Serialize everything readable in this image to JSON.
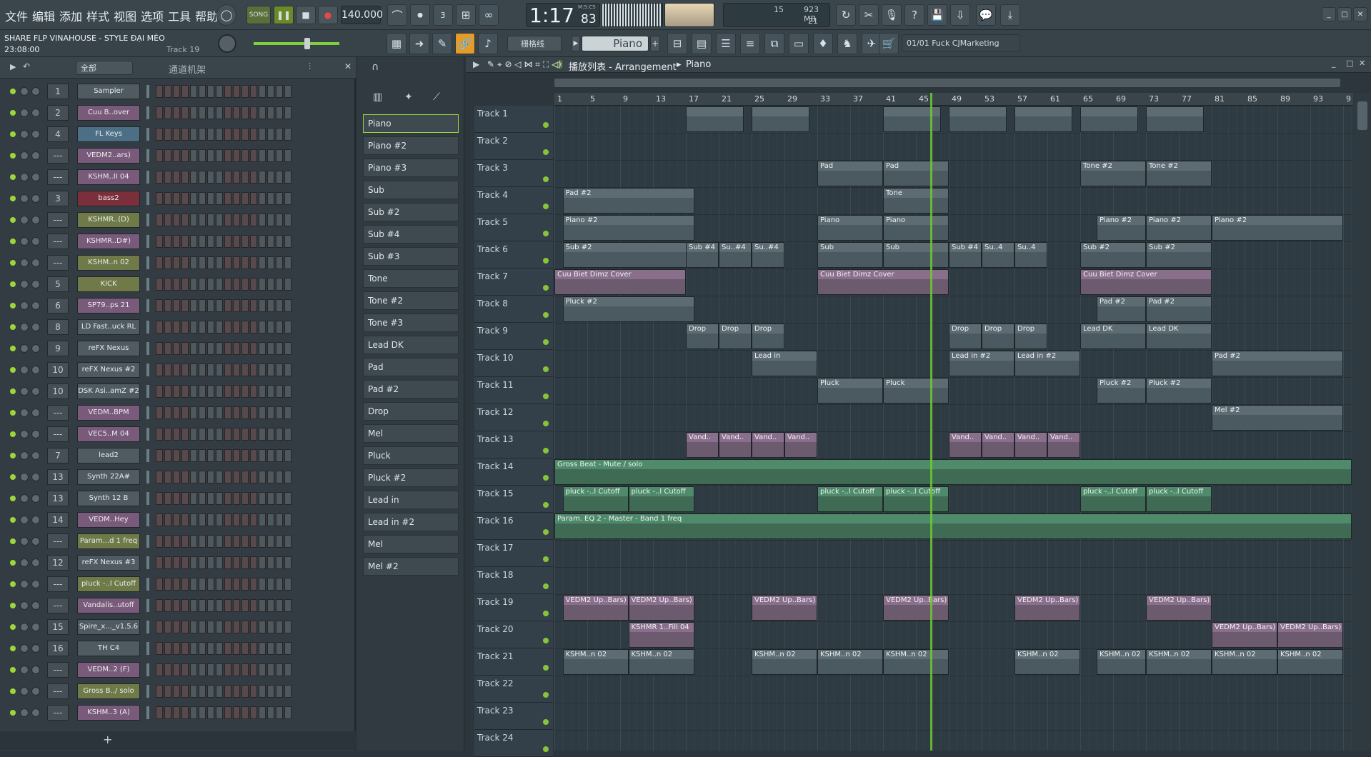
{
  "menu": [
    "文件",
    "编辑",
    "添加",
    "样式",
    "视图",
    "选项",
    "工具",
    "帮助"
  ],
  "transport": {
    "mode": "SONG",
    "tempo": "140.000",
    "time": "1:17",
    "time_small": "83",
    "time_unit": "M:S:CS",
    "cpu": "15",
    "mem": "923 MB",
    "poly": "21"
  },
  "project": {
    "title": "SHARE FLP VINAHOUSE - STYLE ĐẠI MÈO",
    "time": "23:08:00",
    "track": "Track 19"
  },
  "snap": "栅格线",
  "instrument": "Piano",
  "hint": "01/01  Fuck CJMarketing",
  "channel_rack": {
    "filter": "全部",
    "title": "通道机架",
    "channels": [
      {
        "num": "1",
        "name": "Sampler",
        "color": "#4f5b61"
      },
      {
        "num": "2",
        "name": "Cuu B..over",
        "color": "#7a5a7a"
      },
      {
        "num": "4",
        "name": "FL Keys",
        "color": "#4d6f86"
      },
      {
        "num": "---",
        "name": "VEDM2..ars)",
        "color": "#7a5a7a"
      },
      {
        "num": "---",
        "name": "KSHM..II 04",
        "color": "#7a5a7a"
      },
      {
        "num": "3",
        "name": "bass2",
        "color": "#7b2f3a"
      },
      {
        "num": "---",
        "name": "KSHMR..(D)",
        "color": "#6f7a48"
      },
      {
        "num": "---",
        "name": "KSHMR..D#)",
        "color": "#7a5a7a"
      },
      {
        "num": "---",
        "name": "KSHM..n 02",
        "color": "#6f7a48"
      },
      {
        "num": "5",
        "name": "KICK",
        "color": "#6f7a48"
      },
      {
        "num": "6",
        "name": "SP79..ps 21",
        "color": "#7a5a7a"
      },
      {
        "num": "8",
        "name": "LD Fast..uck RL",
        "color": "#4f5b61"
      },
      {
        "num": "9",
        "name": "reFX Nexus",
        "color": "#4f5b61"
      },
      {
        "num": "10",
        "name": "reFX Nexus #2",
        "color": "#4f5b61"
      },
      {
        "num": "10",
        "name": "DSK Asi..amZ #2",
        "color": "#4f5b61"
      },
      {
        "num": "---",
        "name": "VEDM..BPM",
        "color": "#7a5a7a"
      },
      {
        "num": "---",
        "name": "VEC5..M 04",
        "color": "#7a5a7a"
      },
      {
        "num": "7",
        "name": "lead2",
        "color": "#4f5b61"
      },
      {
        "num": "13",
        "name": "Synth 22A#",
        "color": "#4f5b61"
      },
      {
        "num": "13",
        "name": "Synth 12 B",
        "color": "#4f5b61"
      },
      {
        "num": "14",
        "name": "VEDM..Hey",
        "color": "#7a5a7a"
      },
      {
        "num": "---",
        "name": "Param...d 1 freq",
        "color": "#6f7a48"
      },
      {
        "num": "12",
        "name": "reFX Nexus #3",
        "color": "#4f5b61"
      },
      {
        "num": "---",
        "name": "pluck -..l Cutoff",
        "color": "#6f7a48"
      },
      {
        "num": "---",
        "name": "Vandalis..utoff",
        "color": "#7a5a7a"
      },
      {
        "num": "15",
        "name": "Spire_x..._v1.5.6",
        "color": "#4f5b61"
      },
      {
        "num": "16",
        "name": "TH C4",
        "color": "#4f5b61"
      },
      {
        "num": "---",
        "name": "VEDM..2 (F)",
        "color": "#7a5a7a"
      },
      {
        "num": "---",
        "name": "Gross B../ solo",
        "color": "#6f7a48"
      },
      {
        "num": "---",
        "name": "KSHM..3 (A)",
        "color": "#7a5a7a"
      }
    ]
  },
  "picker": [
    "Piano",
    "Piano #2",
    "Piano #3",
    "Sub",
    "Sub #2",
    "Sub #4",
    "Sub #3",
    "Tone",
    "Tone #2",
    "Tone #3",
    "Lead DK",
    "Pad",
    "Pad #2",
    "Drop",
    "Mel",
    "Pluck",
    "Pluck #2",
    "Lead in",
    "Lead in #2",
    "Mel",
    "Mel #2"
  ],
  "playlist": {
    "title": "播放列表 - Arrangement",
    "crumb": "Piano",
    "ruler": [
      "1",
      "5",
      "9",
      "13",
      "17",
      "21",
      "25",
      "29",
      "33",
      "37",
      "41",
      "45",
      "49",
      "53",
      "57",
      "61",
      "65",
      "69",
      "73",
      "77",
      "81",
      "85",
      "89",
      "93",
      "9"
    ],
    "tracks": [
      "Track 1",
      "Track 2",
      "Track 3",
      "Track 4",
      "Track 5",
      "Track 6",
      "Track 7",
      "Track 8",
      "Track 9",
      "Track 10",
      "Track 11",
      "Track 12",
      "Track 13",
      "Track 14",
      "Track 15",
      "Track 16",
      "Track 17",
      "Track 18",
      "Track 19",
      "Track 20",
      "Track 21",
      "Track 22",
      "Track 23",
      "Track 24"
    ],
    "clips": [
      {
        "t": 0,
        "b": 17,
        "w": 7,
        "label": "",
        "type": "cn"
      },
      {
        "t": 0,
        "b": 25,
        "w": 7,
        "label": "",
        "type": "cn"
      },
      {
        "t": 0,
        "b": 41,
        "w": 7,
        "label": "",
        "type": "cn"
      },
      {
        "t": 0,
        "b": 49,
        "w": 7,
        "label": "",
        "type": "cn"
      },
      {
        "t": 0,
        "b": 57,
        "w": 7,
        "label": "",
        "type": "cn"
      },
      {
        "t": 0,
        "b": 65,
        "w": 7,
        "label": "",
        "type": "cn"
      },
      {
        "t": 0,
        "b": 73,
        "w": 7,
        "label": "",
        "type": "cn"
      },
      {
        "t": 2,
        "b": 33,
        "w": 8,
        "label": "Pad",
        "type": "cn"
      },
      {
        "t": 2,
        "b": 41,
        "w": 8,
        "label": "Pad",
        "type": "cn"
      },
      {
        "t": 2,
        "b": 65,
        "w": 8,
        "label": "Tone #2",
        "type": "cn"
      },
      {
        "t": 2,
        "b": 73,
        "w": 8,
        "label": "Tone #2",
        "type": "cn"
      },
      {
        "t": 3,
        "b": 2,
        "w": 16,
        "label": "Pad #2",
        "type": "cn"
      },
      {
        "t": 3,
        "b": 41,
        "w": 8,
        "label": "Tone",
        "type": "cn"
      },
      {
        "t": 4,
        "b": 2,
        "w": 16,
        "label": "Piano #2",
        "type": "cn"
      },
      {
        "t": 4,
        "b": 33,
        "w": 8,
        "label": "Piano",
        "type": "cn"
      },
      {
        "t": 4,
        "b": 41,
        "w": 8,
        "label": "Piano",
        "type": "cn"
      },
      {
        "t": 4,
        "b": 67,
        "w": 6,
        "label": "Piano #2",
        "type": "cn"
      },
      {
        "t": 4,
        "b": 73,
        "w": 8,
        "label": "Piano #2",
        "type": "cn"
      },
      {
        "t": 4,
        "b": 81,
        "w": 16,
        "label": "Piano #2",
        "type": "cn"
      },
      {
        "t": 5,
        "b": 2,
        "w": 16,
        "label": "Sub #2",
        "type": "cn"
      },
      {
        "t": 5,
        "b": 17,
        "w": 4,
        "label": "Sub #4",
        "type": "cn"
      },
      {
        "t": 5,
        "b": 21,
        "w": 4,
        "label": "Su..#4",
        "type": "cn"
      },
      {
        "t": 5,
        "b": 25,
        "w": 4,
        "label": "Su..#4",
        "type": "cn"
      },
      {
        "t": 5,
        "b": 33,
        "w": 8,
        "label": "Sub",
        "type": "cn"
      },
      {
        "t": 5,
        "b": 41,
        "w": 8,
        "label": "Sub",
        "type": "cn"
      },
      {
        "t": 5,
        "b": 49,
        "w": 4,
        "label": "Sub #4",
        "type": "cn"
      },
      {
        "t": 5,
        "b": 53,
        "w": 4,
        "label": "Su..4",
        "type": "cn"
      },
      {
        "t": 5,
        "b": 57,
        "w": 4,
        "label": "Su..4",
        "type": "cn"
      },
      {
        "t": 5,
        "b": 65,
        "w": 8,
        "label": "Sub #2",
        "type": "cn"
      },
      {
        "t": 5,
        "b": 73,
        "w": 8,
        "label": "Sub #2",
        "type": "cn"
      },
      {
        "t": 6,
        "b": 1,
        "w": 16,
        "label": "Cuu Biet Dimz Cover",
        "type": "ca"
      },
      {
        "t": 6,
        "b": 33,
        "w": 16,
        "label": "Cuu Biet Dimz Cover",
        "type": "ca"
      },
      {
        "t": 6,
        "b": 65,
        "w": 16,
        "label": "Cuu Biet Dimz Cover",
        "type": "ca"
      },
      {
        "t": 7,
        "b": 2,
        "w": 16,
        "label": "Pluck #2",
        "type": "cn"
      },
      {
        "t": 7,
        "b": 67,
        "w": 6,
        "label": "Pad #2",
        "type": "cn"
      },
      {
        "t": 7,
        "b": 73,
        "w": 8,
        "label": "Pad #2",
        "type": "cn"
      },
      {
        "t": 8,
        "b": 17,
        "w": 4,
        "label": "Drop",
        "type": "cn"
      },
      {
        "t": 8,
        "b": 21,
        "w": 4,
        "label": "Drop",
        "type": "cn"
      },
      {
        "t": 8,
        "b": 25,
        "w": 4,
        "label": "Drop",
        "type": "cn"
      },
      {
        "t": 8,
        "b": 49,
        "w": 4,
        "label": "Drop",
        "type": "cn"
      },
      {
        "t": 8,
        "b": 53,
        "w": 4,
        "label": "Drop",
        "type": "cn"
      },
      {
        "t": 8,
        "b": 57,
        "w": 4,
        "label": "Drop",
        "type": "cn"
      },
      {
        "t": 8,
        "b": 65,
        "w": 8,
        "label": "Lead DK",
        "type": "cn"
      },
      {
        "t": 8,
        "b": 73,
        "w": 8,
        "label": "Lead DK",
        "type": "cn"
      },
      {
        "t": 9,
        "b": 25,
        "w": 8,
        "label": "Lead in",
        "type": "cn"
      },
      {
        "t": 9,
        "b": 49,
        "w": 8,
        "label": "Lead in #2",
        "type": "cn"
      },
      {
        "t": 9,
        "b": 57,
        "w": 8,
        "label": "Lead in #2",
        "type": "cn"
      },
      {
        "t": 9,
        "b": 81,
        "w": 16,
        "label": "Pad #2",
        "type": "cn"
      },
      {
        "t": 10,
        "b": 33,
        "w": 8,
        "label": "Pluck",
        "type": "cn"
      },
      {
        "t": 10,
        "b": 41,
        "w": 8,
        "label": "Pluck",
        "type": "cn"
      },
      {
        "t": 10,
        "b": 67,
        "w": 6,
        "label": "Pluck #2",
        "type": "cn"
      },
      {
        "t": 10,
        "b": 73,
        "w": 8,
        "label": "Pluck #2",
        "type": "cn"
      },
      {
        "t": 11,
        "b": 81,
        "w": 16,
        "label": "Mel #2",
        "type": "cn"
      },
      {
        "t": 12,
        "b": 17,
        "w": 4,
        "label": "Vand..",
        "type": "ca"
      },
      {
        "t": 12,
        "b": 21,
        "w": 4,
        "label": "Vand..",
        "type": "ca"
      },
      {
        "t": 12,
        "b": 25,
        "w": 4,
        "label": "Vand..",
        "type": "ca"
      },
      {
        "t": 12,
        "b": 29,
        "w": 4,
        "label": "Vand..",
        "type": "ca"
      },
      {
        "t": 12,
        "b": 49,
        "w": 4,
        "label": "Vand..",
        "type": "ca"
      },
      {
        "t": 12,
        "b": 53,
        "w": 4,
        "label": "Vand..",
        "type": "ca"
      },
      {
        "t": 12,
        "b": 57,
        "w": 4,
        "label": "Vand..",
        "type": "ca"
      },
      {
        "t": 12,
        "b": 61,
        "w": 4,
        "label": "Vand..",
        "type": "ca"
      },
      {
        "t": 13,
        "b": 1,
        "w": 97,
        "label": "Gross Beat - Mute / solo",
        "type": "cg"
      },
      {
        "t": 14,
        "b": 2,
        "w": 8,
        "label": "pluck -..l Cutoff",
        "type": "cg"
      },
      {
        "t": 14,
        "b": 10,
        "w": 8,
        "label": "pluck -..l Cutoff",
        "type": "cg"
      },
      {
        "t": 14,
        "b": 33,
        "w": 8,
        "label": "pluck -..l Cutoff",
        "type": "cg"
      },
      {
        "t": 14,
        "b": 41,
        "w": 8,
        "label": "pluck -..l Cutoff",
        "type": "cg"
      },
      {
        "t": 14,
        "b": 65,
        "w": 8,
        "label": "pluck -..l Cutoff",
        "type": "cg"
      },
      {
        "t": 14,
        "b": 73,
        "w": 8,
        "label": "pluck -..l Cutoff",
        "type": "cg"
      },
      {
        "t": 15,
        "b": 1,
        "w": 97,
        "label": "Param. EQ 2 - Master - Band 1 freq",
        "type": "cg"
      },
      {
        "t": 18,
        "b": 2,
        "w": 8,
        "label": "VEDM2 Up..Bars)",
        "type": "ca"
      },
      {
        "t": 18,
        "b": 10,
        "w": 8,
        "label": "VEDM2 Up..Bars)",
        "type": "ca"
      },
      {
        "t": 18,
        "b": 25,
        "w": 8,
        "label": "VEDM2 Up..Bars)",
        "type": "ca"
      },
      {
        "t": 18,
        "b": 41,
        "w": 8,
        "label": "VEDM2 Up..Bars)",
        "type": "ca"
      },
      {
        "t": 18,
        "b": 57,
        "w": 8,
        "label": "VEDM2 Up..Bars)",
        "type": "ca"
      },
      {
        "t": 18,
        "b": 73,
        "w": 8,
        "label": "VEDM2 Up..Bars)",
        "type": "ca"
      },
      {
        "t": 19,
        "b": 10,
        "w": 8,
        "label": "KSHMR 1..Fill 04",
        "type": "ca"
      },
      {
        "t": 19,
        "b": 81,
        "w": 8,
        "label": "VEDM2 Up..Bars)",
        "type": "ca"
      },
      {
        "t": 19,
        "b": 89,
        "w": 8,
        "label": "VEDM2 Up..Bars)",
        "type": "ca"
      },
      {
        "t": 20,
        "b": 2,
        "w": 8,
        "label": "KSHM..n 02",
        "type": "cn"
      },
      {
        "t": 20,
        "b": 10,
        "w": 8,
        "label": "KSHM..n 02",
        "type": "cn"
      },
      {
        "t": 20,
        "b": 25,
        "w": 8,
        "label": "KSHM..n 02",
        "type": "cn"
      },
      {
        "t": 20,
        "b": 33,
        "w": 8,
        "label": "KSHM..n 02",
        "type": "cn"
      },
      {
        "t": 20,
        "b": 41,
        "w": 8,
        "label": "KSHM..n 02",
        "type": "cn"
      },
      {
        "t": 20,
        "b": 57,
        "w": 8,
        "label": "KSHM..n 02",
        "type": "cn"
      },
      {
        "t": 20,
        "b": 67,
        "w": 6,
        "label": "KSHM..n 02",
        "type": "cn"
      },
      {
        "t": 20,
        "b": 73,
        "w": 8,
        "label": "KSHM..n 02",
        "type": "cn"
      },
      {
        "t": 20,
        "b": 81,
        "w": 8,
        "label": "KSHM..n 02",
        "type": "cn"
      },
      {
        "t": 20,
        "b": 89,
        "w": 8,
        "label": "KSHM..n 02",
        "type": "cn"
      }
    ]
  }
}
